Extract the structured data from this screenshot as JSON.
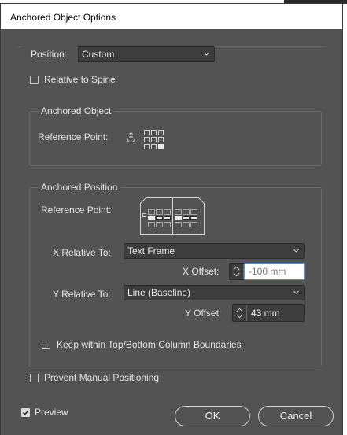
{
  "dialog": {
    "title": "Anchored Object Options"
  },
  "position": {
    "label": "Position:",
    "value": "Custom"
  },
  "relative_to_spine": {
    "label": "Relative to Spine",
    "checked": false
  },
  "anchored_object": {
    "legend": "Anchored Object",
    "reference_point_label": "Reference Point:",
    "icon": "anchor-icon"
  },
  "anchored_position": {
    "legend": "Anchored Position",
    "reference_point_label": "Reference Point:",
    "x_relative_label": "X Relative To:",
    "x_relative_value": "Text Frame",
    "x_offset_label": "X Offset:",
    "x_offset_value": "-100 mm",
    "y_relative_label": "Y Relative To:",
    "y_relative_value": "Line (Baseline)",
    "y_offset_label": "Y Offset:",
    "y_offset_value": "43 mm",
    "keep_within_label": "Keep within Top/Bottom Column Boundaries",
    "keep_within_checked": false
  },
  "prevent_manual": {
    "label": "Prevent Manual Positioning",
    "checked": false
  },
  "footer": {
    "preview_label": "Preview",
    "preview_checked": true,
    "ok_label": "OK",
    "cancel_label": "Cancel"
  },
  "colors": {
    "panel": "#535353",
    "field": "#3d3d3d",
    "text": "#e4e4e4"
  }
}
